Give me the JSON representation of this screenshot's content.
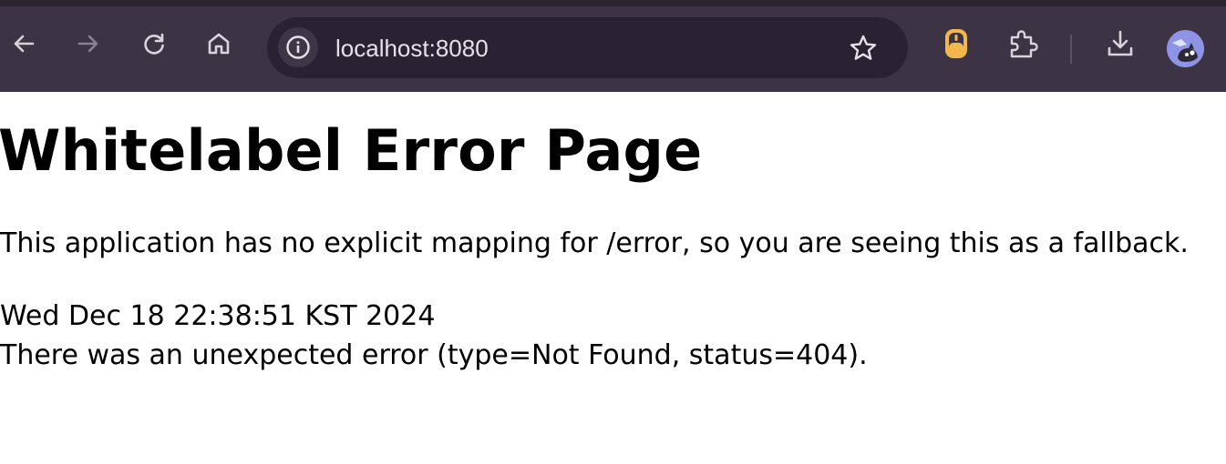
{
  "browser": {
    "url": "localhost:8080",
    "colors": {
      "toolbar_bg": "#3c3344",
      "omnibox_bg": "#2a2232",
      "icon": "#d9d3de",
      "icon_disabled": "#8a8290",
      "extension_accent": "#f2b84b"
    },
    "icons": [
      "back-icon",
      "forward-icon",
      "reload-icon",
      "home-icon",
      "site-info-icon",
      "bookmark-star-icon",
      "extension-mouse-icon",
      "extensions-puzzle-icon",
      "download-icon",
      "profile-avatar"
    ]
  },
  "page": {
    "title": "Whitelabel Error Page",
    "message": "This application has no explicit mapping for /error, so you are seeing this as a fallback.",
    "timestamp": "Wed Dec 18 22:38:51 KST 2024",
    "error_detail": "There was an unexpected error (type=Not Found, status=404)."
  }
}
